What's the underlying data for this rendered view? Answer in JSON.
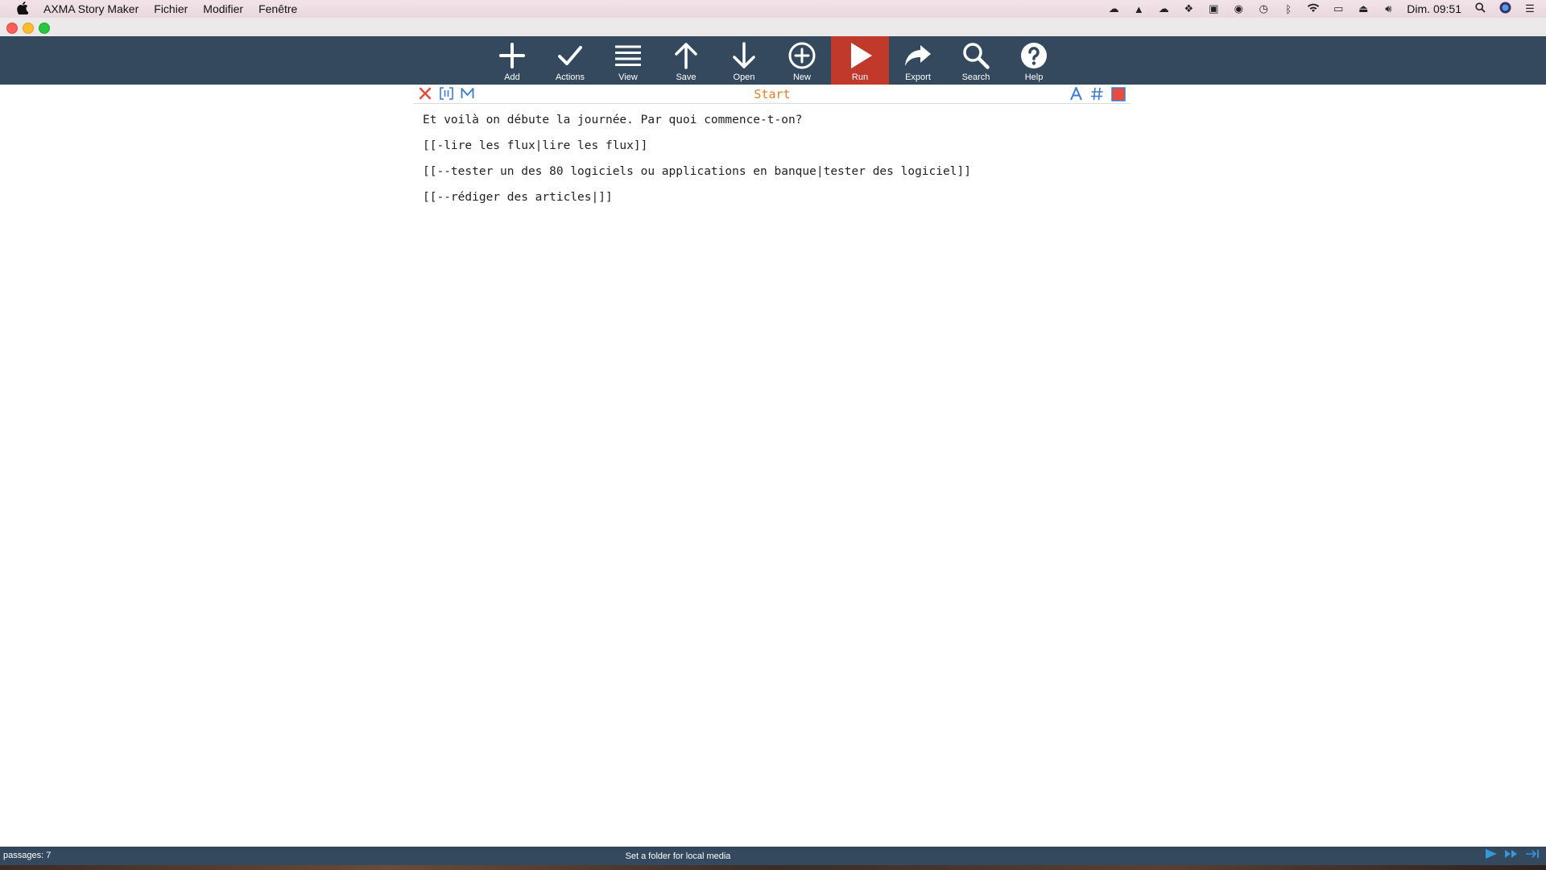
{
  "menubar": {
    "apple_icon": "apple-logo-icon",
    "app_name": "AXMA Story Maker",
    "items": [
      "Fichier",
      "Modifier",
      "Fenêtre"
    ],
    "clock": "Dim. 09:51",
    "status_icons": [
      "creative-cloud-icon",
      "google-drive-icon",
      "cloud-icon",
      "dropbox-icon",
      "inbox-icon",
      "toggle-icon",
      "time-machine-icon",
      "bluetooth-icon",
      "wifi-icon",
      "airplay-icon",
      "eject-icon",
      "volume-icon",
      "spotlight-icon",
      "siri-icon",
      "list-icon"
    ]
  },
  "toolbar": {
    "buttons": [
      {
        "id": "add",
        "label": "Add",
        "icon": "plus-icon"
      },
      {
        "id": "actions",
        "label": "Actions",
        "icon": "check-icon"
      },
      {
        "id": "view",
        "label": "View",
        "icon": "menu-icon"
      },
      {
        "id": "save",
        "label": "Save",
        "icon": "arrow-up-icon"
      },
      {
        "id": "open",
        "label": "Open",
        "icon": "arrow-down-icon"
      },
      {
        "id": "new",
        "label": "New",
        "icon": "plus-circle-icon"
      },
      {
        "id": "run",
        "label": "Run",
        "icon": "play-icon",
        "active": true
      },
      {
        "id": "export",
        "label": "Export",
        "icon": "share-arrow-icon"
      },
      {
        "id": "search",
        "label": "Search",
        "icon": "search-icon"
      },
      {
        "id": "help",
        "label": "Help",
        "icon": "help-circle-icon"
      }
    ],
    "background": "#34495e",
    "active_color": "#c0392b"
  },
  "passage": {
    "title": "Start",
    "title_color": "#e67e22",
    "left_icons": [
      "close-icon",
      "brackets-icon",
      "markdown-icon"
    ],
    "right_icons": [
      "font-icon",
      "hash-icon",
      "color-swatch-icon"
    ],
    "lines": [
      "Et voilà on débute la journée. Par quoi commence-t-on?",
      "[[-lire les flux|lire les flux]]",
      "[[--tester un des 80 logiciels ou applications en banque|tester des logiciel]]",
      "[[--rédiger des articles|]]"
    ]
  },
  "statusbar": {
    "passages": "passages: 7",
    "message": "Set a folder for local media",
    "right_icons": [
      "play-icon",
      "fast-forward-icon",
      "step-end-icon"
    ]
  }
}
